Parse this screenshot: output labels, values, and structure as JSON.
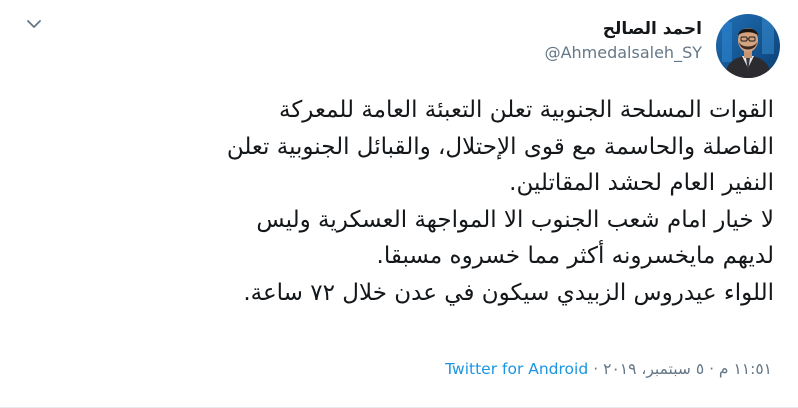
{
  "tweet": {
    "author": {
      "display_name": "احمد الصالح",
      "handle": "@Ahmedalsaleh_SY",
      "avatar_icon": "profile-photo"
    },
    "menu_icon": "chevron-down-icon",
    "lines": [
      "القوات المسلحة الجنوبية تعلن التعبئة العامة للمعركة",
      "الفاصلة والحاسمة مع قوى الإحتلال، والقبائل الجنوبية تعلن",
      "النفير العام لحشد المقاتلين.",
      "لا خيار امام شعب الجنوب الا المواجهة العسكرية وليس",
      "لديهم مايخسرونه أكثر مما خسروه مسبقا.",
      "اللواء عيدروس الزبيدي سيكون في عدن خلال ٧٢ ساعة."
    ],
    "timestamp": "١١:٥١ م · ٥ سبتمبر، ٢٠١٩",
    "separator": "·",
    "source": "Twitter for Android"
  },
  "colors": {
    "text": "#14171a",
    "secondary": "#657786",
    "link": "#1b95e0"
  }
}
